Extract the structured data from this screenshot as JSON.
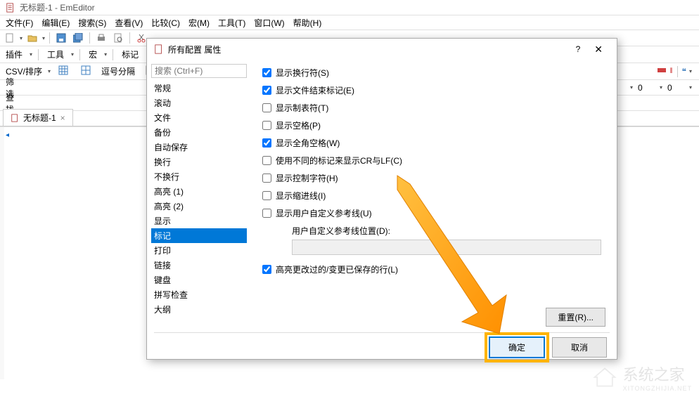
{
  "window": {
    "title": "无标题-1 - EmEditor"
  },
  "menu": {
    "file": "文件(F)",
    "edit": "编辑(E)",
    "search": "搜索(S)",
    "view": "查看(V)",
    "compare": "比较(C)",
    "macro": "宏(M)",
    "tools": "工具(T)",
    "window": "窗口(W)",
    "help": "帮助(H)"
  },
  "toolbar2": {
    "plugins": "插件",
    "tools": "工具",
    "macro": "宏",
    "markers": "标记"
  },
  "csvbar": {
    "label": "CSV/排序",
    "comma": "逗号分隔"
  },
  "filter": {
    "label": "筛选"
  },
  "find": {
    "label": "查找"
  },
  "rightctrl": {
    "val1": "0",
    "val2": "0"
  },
  "tab": {
    "name": "无标题-1"
  },
  "dialog": {
    "title": "所有配置 属性",
    "search_placeholder": "搜索 (Ctrl+F)",
    "categories": [
      "常规",
      "滚动",
      "文件",
      "备份",
      "自动保存",
      "换行",
      "不换行",
      "高亮 (1)",
      "高亮 (2)",
      "显示",
      "标记",
      "打印",
      "链接",
      "键盘",
      "拼写检查",
      "大纲"
    ],
    "selected_index": 10,
    "options": {
      "show_newline": {
        "label": "显示换行符(S)",
        "checked": true
      },
      "show_eof": {
        "label": "显示文件结束标记(E)",
        "checked": true
      },
      "show_tab": {
        "label": "显示制表符(T)",
        "checked": false
      },
      "show_space": {
        "label": "显示空格(P)",
        "checked": false
      },
      "show_fullwidth_space": {
        "label": "显示全角空格(W)",
        "checked": true
      },
      "diff_crlf": {
        "label": "使用不同的标记来显示CR与LF(C)",
        "checked": false
      },
      "show_ctrl": {
        "label": "显示控制字符(H)",
        "checked": false
      },
      "show_indent": {
        "label": "显示缩进线(I)",
        "checked": false
      },
      "show_user_guide": {
        "label": "显示用户自定义参考线(U)",
        "checked": false
      },
      "guide_pos_label": "用户自定义参考线位置(D):",
      "guide_pos_value": "",
      "highlight_changed": {
        "label": "高亮更改过的/变更已保存的行(L)",
        "checked": true
      }
    },
    "reset": "重置(R)...",
    "ok": "确定",
    "cancel": "取消"
  },
  "watermark": {
    "text": "系统之家",
    "sub": "XITONGZHIJIA.NET"
  }
}
